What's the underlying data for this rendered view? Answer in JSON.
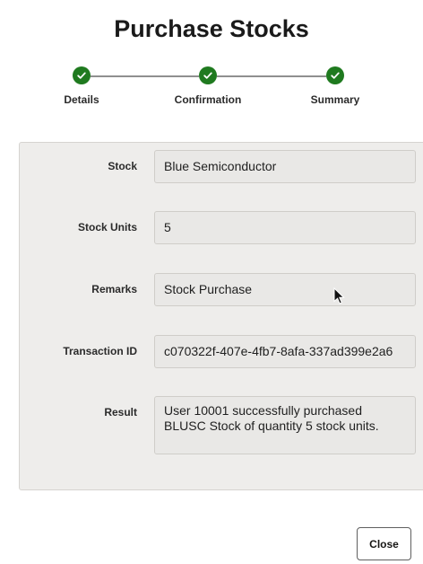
{
  "header": {
    "title": "Purchase Stocks"
  },
  "stepper": {
    "steps": [
      {
        "label": "Details",
        "status": "complete"
      },
      {
        "label": "Confirmation",
        "status": "complete"
      },
      {
        "label": "Summary",
        "status": "complete"
      }
    ],
    "complete_color": "#1f7a1f",
    "check_icon": "checkmark-icon"
  },
  "form": {
    "stock": {
      "label": "Stock",
      "value": "Blue Semiconductor"
    },
    "stock_units": {
      "label": "Stock Units",
      "value": "5"
    },
    "remarks": {
      "label": "Remarks",
      "value": "Stock Purchase"
    },
    "transaction_id": {
      "label": "Transaction ID",
      "value": "c070322f-407e-4fb7-8afa-337ad399e2a6"
    },
    "result": {
      "label": "Result",
      "value": "User 10001 successfully purchased BLUSC Stock of quantity 5 stock units."
    }
  },
  "footer": {
    "close_label": "Close"
  }
}
